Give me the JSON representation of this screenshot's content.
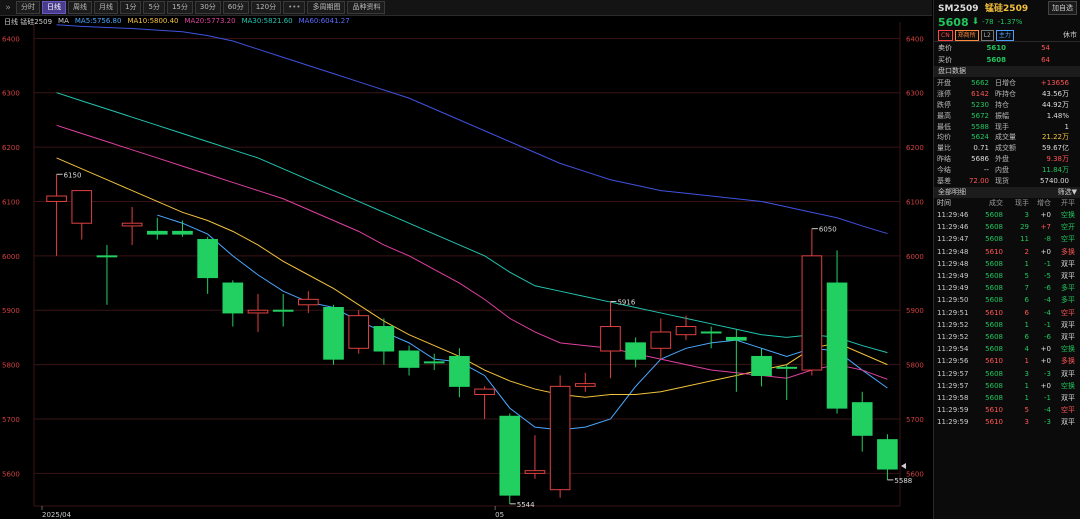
{
  "toolbar": {
    "items": [
      "分时",
      "日线",
      "周线",
      "月线",
      "1分",
      "5分",
      "15分",
      "30分",
      "60分",
      "120分",
      "•••",
      "多周期图",
      "品种资料"
    ],
    "active_index": 1
  },
  "legend": {
    "title": "日线 锰硅2509",
    "ma": "MA",
    "ma5": "MA5:5756.80",
    "ma10": "MA10:5800.40",
    "ma20": "MA20:5773.20",
    "ma30": "MA30:5821.60",
    "ma60": "MA60:6041.27",
    "colors": {
      "ma5": "#4aa8ff",
      "ma10": "#f3c23c",
      "ma20": "#e040a0",
      "ma30": "#21c5b0",
      "ma60": "#3f52e0"
    }
  },
  "chart_data": {
    "type": "candlestick",
    "ylim": [
      5540,
      6430
    ],
    "y_ticks": [
      5600,
      5700,
      5800,
      5900,
      6000,
      6100,
      6200,
      6300,
      6400
    ],
    "x_labels": [
      {
        "index": 0,
        "label": "2025/04"
      },
      {
        "index": 18,
        "label": "05"
      }
    ],
    "candles": [
      {
        "o": 6100,
        "c": 6110,
        "h": 6150,
        "l": 6000
      },
      {
        "o": 6060,
        "c": 6120,
        "h": 6120,
        "l": 6030
      },
      {
        "o": 6000,
        "c": 6000,
        "h": 6020,
        "l": 5910
      },
      {
        "o": 6055,
        "c": 6060,
        "h": 6090,
        "l": 6020
      },
      {
        "o": 6045,
        "c": 6040,
        "h": 6070,
        "l": 6030
      },
      {
        "o": 6045,
        "c": 6040,
        "h": 6065,
        "l": 6035
      },
      {
        "o": 6030,
        "c": 5960,
        "h": 6035,
        "l": 5930
      },
      {
        "o": 5950,
        "c": 5895,
        "h": 5955,
        "l": 5870
      },
      {
        "o": 5895,
        "c": 5900,
        "h": 5930,
        "l": 5860
      },
      {
        "o": 5900,
        "c": 5900,
        "h": 5930,
        "l": 5870
      },
      {
        "o": 5910,
        "c": 5920,
        "h": 5935,
        "l": 5895
      },
      {
        "o": 5905,
        "c": 5810,
        "h": 5910,
        "l": 5800
      },
      {
        "o": 5830,
        "c": 5890,
        "h": 5900,
        "l": 5820
      },
      {
        "o": 5870,
        "c": 5825,
        "h": 5885,
        "l": 5800
      },
      {
        "o": 5825,
        "c": 5795,
        "h": 5835,
        "l": 5780
      },
      {
        "o": 5805,
        "c": 5805,
        "h": 5820,
        "l": 5790
      },
      {
        "o": 5815,
        "c": 5760,
        "h": 5830,
        "l": 5740
      },
      {
        "o": 5745,
        "c": 5755,
        "h": 5760,
        "l": 5700
      },
      {
        "o": 5705,
        "c": 5560,
        "h": 5710,
        "l": 5544
      },
      {
        "o": 5600,
        "c": 5605,
        "h": 5670,
        "l": 5590
      },
      {
        "o": 5570,
        "c": 5760,
        "h": 5780,
        "l": 5555
      },
      {
        "o": 5760,
        "c": 5765,
        "h": 5785,
        "l": 5750
      },
      {
        "o": 5825,
        "c": 5870,
        "h": 5916,
        "l": 5775
      },
      {
        "o": 5840,
        "c": 5810,
        "h": 5850,
        "l": 5795
      },
      {
        "o": 5830,
        "c": 5860,
        "h": 5885,
        "l": 5810
      },
      {
        "o": 5855,
        "c": 5870,
        "h": 5890,
        "l": 5845
      },
      {
        "o": 5860,
        "c": 5860,
        "h": 5870,
        "l": 5830
      },
      {
        "o": 5850,
        "c": 5845,
        "h": 5865,
        "l": 5750
      },
      {
        "o": 5815,
        "c": 5780,
        "h": 5830,
        "l": 5760
      },
      {
        "o": 5795,
        "c": 5795,
        "h": 5800,
        "l": 5735
      },
      {
        "o": 5790,
        "c": 6000,
        "h": 6050,
        "l": 5780
      },
      {
        "o": 5950,
        "c": 5720,
        "h": 6010,
        "l": 5710
      },
      {
        "o": 5730,
        "c": 5670,
        "h": 5750,
        "l": 5640
      },
      {
        "o": 5662,
        "c": 5608,
        "h": 5672,
        "l": 5588
      }
    ],
    "high_label": "6150",
    "mark_labels": [
      {
        "index": 0,
        "value": "6150"
      },
      {
        "index": 18,
        "value": "5544"
      },
      {
        "index": 22,
        "value": "5916"
      },
      {
        "index": 30,
        "value": "6050"
      },
      {
        "index": 33,
        "value": "5588"
      }
    ],
    "ma_series": {
      "ma5": [
        null,
        null,
        null,
        null,
        6075,
        6060,
        6040,
        6000,
        5965,
        5935,
        5915,
        5905,
        5880,
        5860,
        5840,
        5810,
        5805,
        5780,
        5720,
        5685,
        5680,
        5685,
        5700,
        5760,
        5810,
        5830,
        5840,
        5845,
        5830,
        5815,
        5830,
        5825,
        5790,
        5757
      ],
      "ma10": [
        6180,
        6160,
        6140,
        6120,
        6100,
        6080,
        6065,
        6045,
        6020,
        5990,
        5965,
        5940,
        5910,
        5880,
        5855,
        5835,
        5815,
        5790,
        5770,
        5755,
        5745,
        5740,
        5745,
        5745,
        5750,
        5760,
        5770,
        5780,
        5790,
        5800,
        5830,
        5840,
        5820,
        5800
      ],
      "ma20": [
        6240,
        6225,
        6210,
        6195,
        6180,
        6165,
        6150,
        6135,
        6120,
        6105,
        6085,
        6065,
        6045,
        6020,
        6000,
        5975,
        5950,
        5920,
        5885,
        5860,
        5840,
        5835,
        5830,
        5820,
        5810,
        5800,
        5790,
        5785,
        5780,
        5775,
        5790,
        5800,
        5790,
        5773
      ],
      "ma30": [
        6300,
        6285,
        6270,
        6255,
        6240,
        6225,
        6210,
        6195,
        6180,
        6160,
        6140,
        6120,
        6100,
        6080,
        6060,
        6040,
        6020,
        6000,
        5970,
        5945,
        5935,
        5925,
        5915,
        5905,
        5895,
        5885,
        5875,
        5865,
        5855,
        5850,
        5855,
        5850,
        5835,
        5822
      ],
      "ma60": [
        6425,
        6422,
        6420,
        6418,
        6415,
        6412,
        6405,
        6395,
        6380,
        6365,
        6350,
        6335,
        6320,
        6305,
        6290,
        6270,
        6250,
        6230,
        6210,
        6190,
        6170,
        6155,
        6140,
        6130,
        6120,
        6115,
        6110,
        6105,
        6100,
        6090,
        6080,
        6070,
        6055,
        6041
      ]
    }
  },
  "panel": {
    "code": "SM2509",
    "name": "锰硅2509",
    "add_button": "加自选",
    "price": "5608",
    "change": "-78",
    "change_pct": "-1.37%",
    "tags": [
      "CN",
      "郑商所",
      "L2",
      "主力"
    ],
    "status": "休市",
    "ask_label": "卖价",
    "ask_price": "5610",
    "ask_vol": "54",
    "bid_label": "买价",
    "bid_price": "5608",
    "bid_vol": "64",
    "data_title": "盘口数据",
    "stats": [
      {
        "k": "开盘",
        "v": "5662",
        "vc": "c-g",
        "k2": "日增仓",
        "v2": "+13656",
        "v2c": "c-r"
      },
      {
        "k": "涨停",
        "v": "6142",
        "vc": "c-r",
        "k2": "昨持仓",
        "v2": "43.56万",
        "v2c": "c-w"
      },
      {
        "k": "跌停",
        "v": "5230",
        "vc": "c-g",
        "k2": "持仓",
        "v2": "44.92万",
        "v2c": "c-w"
      },
      {
        "k": "最高",
        "v": "5672",
        "vc": "c-g",
        "k2": "振幅",
        "v2": "1.48%",
        "v2c": "c-w"
      },
      {
        "k": "最低",
        "v": "5588",
        "vc": "c-g",
        "k2": "现手",
        "v2": "1",
        "v2c": "c-w"
      },
      {
        "k": "均价",
        "v": "5624",
        "vc": "c-g",
        "k2": "成交量",
        "v2": "21.22万",
        "v2c": "c-y"
      },
      {
        "k": "量比",
        "v": "0.71",
        "vc": "c-w",
        "k2": "成交额",
        "v2": "59.67亿",
        "v2c": "c-w"
      },
      {
        "k": "昨结",
        "v": "5686",
        "vc": "c-w",
        "k2": "外盘",
        "v2": "9.38万",
        "v2c": "c-r"
      },
      {
        "k": "今结",
        "v": "--",
        "vc": "c-w",
        "k2": "内盘",
        "v2": "11.84万",
        "v2c": "c-g"
      },
      {
        "k": "基差",
        "v": "72.00",
        "vc": "c-r",
        "k2": "现货",
        "v2": "5740.00",
        "v2c": "c-w"
      }
    ],
    "trades_title": "全部明细",
    "trades_filter": "筛选",
    "trades_header": [
      "时间",
      "成交",
      "现手",
      "增仓",
      "开平"
    ],
    "trades": [
      {
        "t": "11:29:46",
        "p": "5608",
        "pc": "c-g",
        "v": "3",
        "vc": "c-g",
        "oi": "+0",
        "oic": "c-w",
        "ty": "空换",
        "tyc": "c-g"
      },
      {
        "t": "11:29:46",
        "p": "5608",
        "pc": "c-g",
        "v": "29",
        "vc": "c-g",
        "oi": "+7",
        "oic": "c-r",
        "ty": "空开",
        "tyc": "c-g"
      },
      {
        "t": "11:29:47",
        "p": "5608",
        "pc": "c-g",
        "v": "11",
        "vc": "c-g",
        "oi": "-8",
        "oic": "c-g",
        "ty": "空平",
        "tyc": "c-g"
      },
      {
        "t": "11:29:48",
        "p": "5610",
        "pc": "c-r",
        "v": "2",
        "vc": "c-r",
        "oi": "+0",
        "oic": "c-w",
        "ty": "多换",
        "tyc": "c-r"
      },
      {
        "t": "11:29:48",
        "p": "5608",
        "pc": "c-g",
        "v": "1",
        "vc": "c-g",
        "oi": "-1",
        "oic": "c-g",
        "ty": "双平",
        "tyc": "c-w"
      },
      {
        "t": "11:29:49",
        "p": "5608",
        "pc": "c-g",
        "v": "5",
        "vc": "c-g",
        "oi": "-5",
        "oic": "c-g",
        "ty": "双平",
        "tyc": "c-w"
      },
      {
        "t": "11:29:49",
        "p": "5608",
        "pc": "c-g",
        "v": "7",
        "vc": "c-g",
        "oi": "-6",
        "oic": "c-g",
        "ty": "多平",
        "tyc": "c-g"
      },
      {
        "t": "11:29:50",
        "p": "5608",
        "pc": "c-g",
        "v": "6",
        "vc": "c-g",
        "oi": "-4",
        "oic": "c-g",
        "ty": "多平",
        "tyc": "c-g"
      },
      {
        "t": "11:29:51",
        "p": "5610",
        "pc": "c-r",
        "v": "6",
        "vc": "c-r",
        "oi": "-4",
        "oic": "c-g",
        "ty": "空平",
        "tyc": "c-r"
      },
      {
        "t": "11:29:52",
        "p": "5608",
        "pc": "c-g",
        "v": "1",
        "vc": "c-g",
        "oi": "-1",
        "oic": "c-g",
        "ty": "双平",
        "tyc": "c-w"
      },
      {
        "t": "11:29:52",
        "p": "5608",
        "pc": "c-g",
        "v": "6",
        "vc": "c-g",
        "oi": "-6",
        "oic": "c-g",
        "ty": "双平",
        "tyc": "c-w"
      },
      {
        "t": "11:29:54",
        "p": "5608",
        "pc": "c-g",
        "v": "4",
        "vc": "c-g",
        "oi": "+0",
        "oic": "c-w",
        "ty": "空换",
        "tyc": "c-g"
      },
      {
        "t": "11:29:56",
        "p": "5610",
        "pc": "c-r",
        "v": "1",
        "vc": "c-r",
        "oi": "+0",
        "oic": "c-w",
        "ty": "多换",
        "tyc": "c-r"
      },
      {
        "t": "11:29:57",
        "p": "5608",
        "pc": "c-g",
        "v": "3",
        "vc": "c-g",
        "oi": "-3",
        "oic": "c-g",
        "ty": "双平",
        "tyc": "c-w"
      },
      {
        "t": "11:29:57",
        "p": "5608",
        "pc": "c-g",
        "v": "1",
        "vc": "c-g",
        "oi": "+0",
        "oic": "c-w",
        "ty": "空换",
        "tyc": "c-g"
      },
      {
        "t": "11:29:58",
        "p": "5608",
        "pc": "c-g",
        "v": "1",
        "vc": "c-g",
        "oi": "-1",
        "oic": "c-g",
        "ty": "双平",
        "tyc": "c-w"
      },
      {
        "t": "11:29:59",
        "p": "5610",
        "pc": "c-r",
        "v": "5",
        "vc": "c-r",
        "oi": "-4",
        "oic": "c-g",
        "ty": "空平",
        "tyc": "c-r"
      },
      {
        "t": "11:29:59",
        "p": "5610",
        "pc": "c-r",
        "v": "3",
        "vc": "c-r",
        "oi": "-3",
        "oic": "c-g",
        "ty": "双平",
        "tyc": "c-w"
      }
    ]
  }
}
